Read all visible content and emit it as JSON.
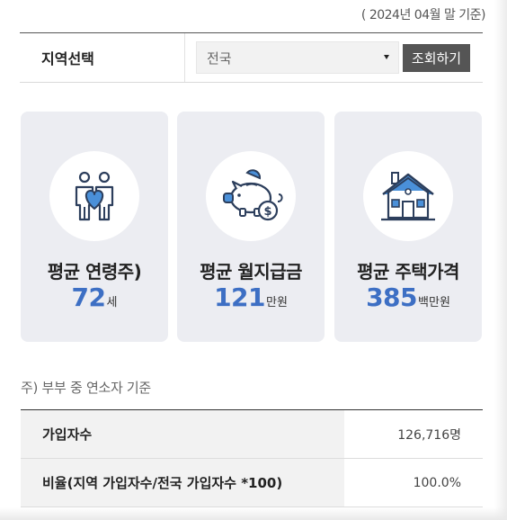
{
  "base_date": "( 2024년 04월 말 기준)",
  "region": {
    "label": "지역선택",
    "selected": "전국",
    "button_label": "조회하기"
  },
  "cards": [
    {
      "title": "평균 연령주)",
      "value": "72",
      "unit": "세",
      "icon": "couple-heart-icon"
    },
    {
      "title": "평균 월지급금",
      "value": "121",
      "unit": "만원",
      "icon": "piggy-bank-icon"
    },
    {
      "title": "평균 주택가격",
      "value": "385",
      "unit": "백만원",
      "icon": "house-icon"
    }
  ],
  "note": "주) 부부 중 연소자 기준",
  "stats": [
    {
      "label": "가입자수",
      "value": "126,716명"
    },
    {
      "label": "비율(지역 가입자수/전국 가입자수 *100)",
      "value": "100.0%"
    }
  ],
  "colors": {
    "accent": "#3d6fc4",
    "card_bg": "#ecedf2",
    "icon_navy": "#2c3e5c",
    "icon_blue": "#4a90d9"
  }
}
